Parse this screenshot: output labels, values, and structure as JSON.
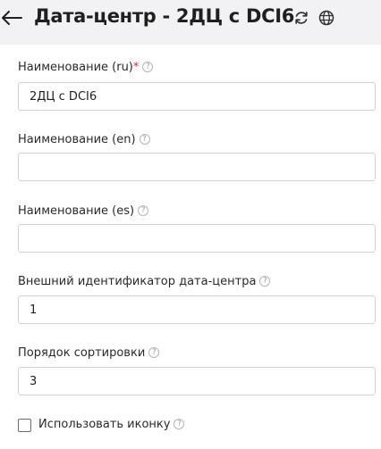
{
  "header": {
    "title": "Дата-центр - 2ДЦ с DCI6",
    "back_icon": "arrow-left-icon",
    "refresh_icon": "refresh-icon",
    "globe_icon": "globe-icon"
  },
  "form": {
    "fields": [
      {
        "label": "Наименование (ru)",
        "required_mark": "*",
        "help": "?",
        "value": "2ДЦ с DCI6"
      },
      {
        "label": "Наименование (en)",
        "help": "?",
        "value": ""
      },
      {
        "label": "Наименование (es)",
        "help": "?",
        "value": ""
      },
      {
        "label": "Внешний идентификатор дата-центра",
        "help": "?",
        "value": "1"
      },
      {
        "label": "Порядок сортировки",
        "help": "?",
        "value": "3"
      }
    ],
    "use_icon": {
      "label": "Использовать иконку",
      "help": "?",
      "checked": false
    }
  },
  "colors": {
    "required": "#d6283c",
    "background": "#f2f2f4",
    "card": "#ffffff",
    "border": "#cfd2d6"
  }
}
